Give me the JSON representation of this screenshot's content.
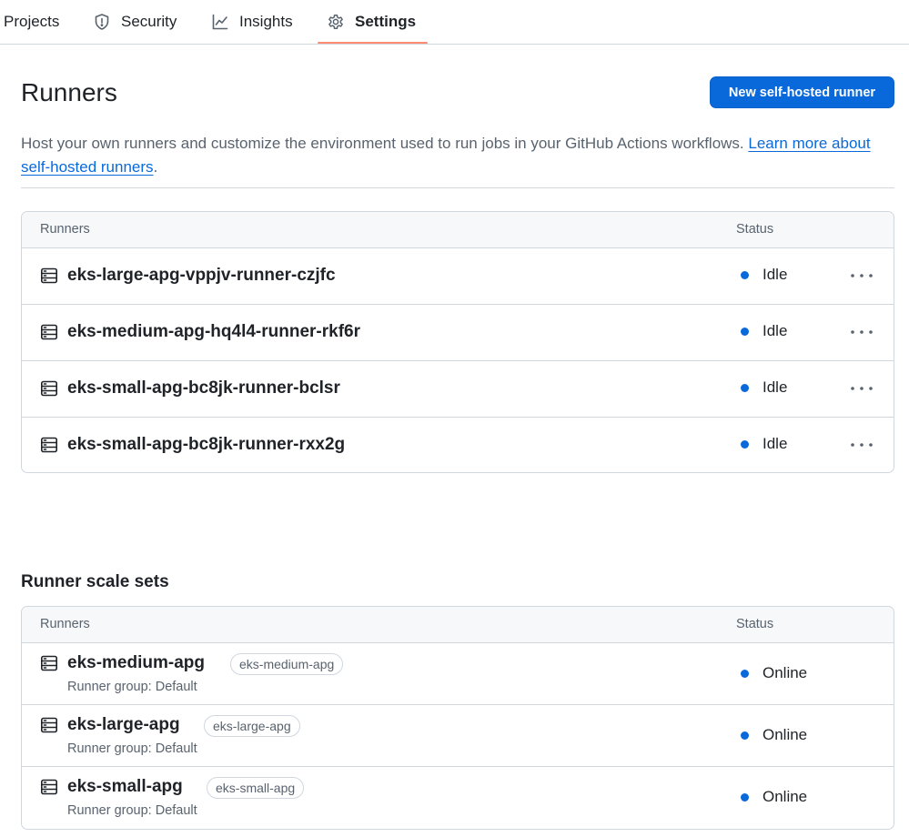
{
  "nav": {
    "tabs": [
      {
        "label": "Projects",
        "icon": "project-icon"
      },
      {
        "label": "Security",
        "icon": "shield-icon"
      },
      {
        "label": "Insights",
        "icon": "graph-icon"
      },
      {
        "label": "Settings",
        "icon": "gear-icon",
        "active": true
      }
    ]
  },
  "header": {
    "title": "Runners",
    "new_button": "New self-hosted runner",
    "description": "Host your own runners and customize the environment used to run jobs in your GitHub Actions workflows. ",
    "link_text": "Learn more about self-hosted runners",
    "description_end": "."
  },
  "runners": {
    "col_runners": "Runners",
    "col_status": "Status",
    "rows": [
      {
        "name": "eks-large-apg-vppjv-runner-czjfc",
        "status": "Idle"
      },
      {
        "name": "eks-medium-apg-hq4l4-runner-rkf6r",
        "status": "Idle"
      },
      {
        "name": "eks-small-apg-bc8jk-runner-bclsr",
        "status": "Idle"
      },
      {
        "name": "eks-small-apg-bc8jk-runner-rxx2g",
        "status": "Idle"
      }
    ]
  },
  "scale_sets": {
    "title": "Runner scale sets",
    "col_runners": "Runners",
    "col_status": "Status",
    "rows": [
      {
        "name": "eks-medium-apg",
        "label": "eks-medium-apg",
        "group": "Runner group: Default",
        "status": "Online"
      },
      {
        "name": "eks-large-apg",
        "label": "eks-large-apg",
        "group": "Runner group: Default",
        "status": "Online"
      },
      {
        "name": "eks-small-apg",
        "label": "eks-small-apg",
        "group": "Runner group: Default",
        "status": "Online"
      }
    ]
  },
  "colors": {
    "accent": "#0969da",
    "tab_underline": "#fd8c73",
    "status_dot": "#0969da",
    "border": "#d0d7de"
  }
}
